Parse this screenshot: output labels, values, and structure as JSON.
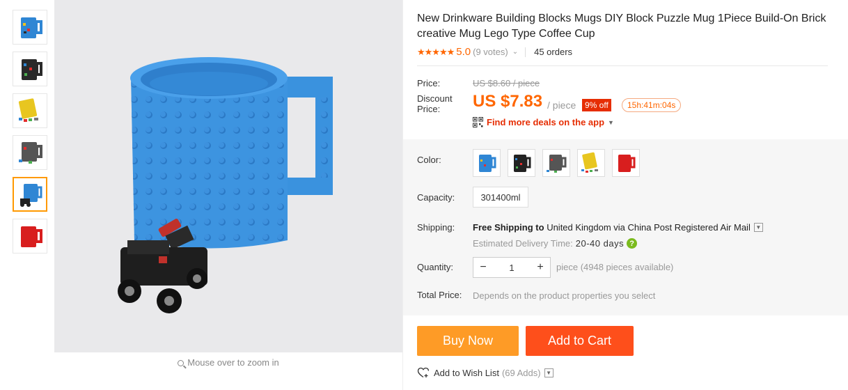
{
  "product": {
    "title": "New Drinkware Building Blocks Mugs DIY Block Puzzle Mug 1Piece Build-On Brick creative Mug Lego Type Coffee Cup",
    "rating": {
      "stars": "★★★★★",
      "score": "5.0",
      "votes": "(9 votes)",
      "orders": "45 orders"
    }
  },
  "gallery": {
    "thumbnails": [
      {
        "icon": "blue-mug-thumb"
      },
      {
        "icon": "black-mug-thumb"
      },
      {
        "icon": "yellow-mug-thumb"
      },
      {
        "icon": "gray-mug-thumb"
      },
      {
        "icon": "blue-mug-car-thumb",
        "active": true
      },
      {
        "icon": "red-mug-thumb"
      }
    ],
    "zoom_hint": "Mouse over to zoom in"
  },
  "pricing": {
    "price_label": "Price:",
    "original_price": "US $8.60 / piece",
    "discount_label_1": "Discount",
    "discount_label_2": "Price:",
    "discount_price": "US $7.83",
    "per_piece": "/ piece",
    "off_badge": "9% off",
    "timer": "15h:41m:04s",
    "app_deals": "Find more deals on the app"
  },
  "options": {
    "color_label": "Color:",
    "colors": [
      "#3b8fd9",
      "#222222",
      "#555555",
      "#e8c620",
      "#d81e1e"
    ],
    "capacity_label": "Capacity:",
    "capacity_value": "301400ml",
    "shipping_label": "Shipping:",
    "shipping_free": "Free Shipping to",
    "shipping_dest": "United Kingdom via China Post Registered Air Mail",
    "delivery_label": "Estimated Delivery Time:",
    "delivery_days": "20-40 days",
    "help_icon": "?",
    "quantity_label": "Quantity:",
    "quantity_minus": "−",
    "quantity_value": "1",
    "quantity_plus": "+",
    "quantity_note": "piece (4948 pieces available)",
    "total_label": "Total Price:",
    "total_note": "Depends on the product properties you select"
  },
  "actions": {
    "buy_now": "Buy Now",
    "add_to_cart": "Add to Cart",
    "wish_list": "Add to Wish List",
    "wish_adds": "(69 Adds)"
  },
  "colors": {
    "accent_orange": "#ff6600",
    "buy_now": "#fe9b26",
    "add_to_cart": "#fe4f1b",
    "badge_red": "#e62e04"
  }
}
